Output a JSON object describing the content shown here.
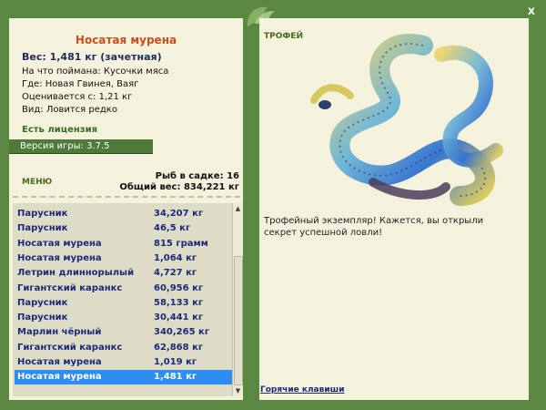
{
  "window": {
    "close_glyph": "x"
  },
  "fish": {
    "title": "Носатая мурена",
    "weight_line": "Вес: 1,481 кг (зачетная)",
    "details": [
      "На что поймана: Кусочки мяса",
      "Где: Новая Гвинея, Ваяг",
      "Оценивается с: 1,21 кг",
      "Вид: Ловится редко"
    ]
  },
  "license": "Есть лицензия",
  "version": "Версия игры: 3.7.5",
  "menu_label": "МЕНЮ",
  "stats": {
    "count": "Рыб в садке: 16",
    "total_weight": "Общий вес: 834,221 кг"
  },
  "catch_list": [
    {
      "name": "Парусник",
      "weight": "34,207 кг"
    },
    {
      "name": "Парусник",
      "weight": "46,5 кг"
    },
    {
      "name": "Носатая мурена",
      "weight": "815 грамм"
    },
    {
      "name": "Носатая мурена",
      "weight": "1,064 кг"
    },
    {
      "name": "Летрин длиннорылый",
      "weight": "4,727 кг"
    },
    {
      "name": "Гигантский каранкс",
      "weight": "60,956 кг"
    },
    {
      "name": "Парусник",
      "weight": "58,133 кг"
    },
    {
      "name": "Парусник",
      "weight": "30,441 кг"
    },
    {
      "name": "Марлин чёрный",
      "weight": "340,265 кг"
    },
    {
      "name": "Гигантский каранкс",
      "weight": "62,868 кг"
    },
    {
      "name": "Носатая мурена",
      "weight": "1,019 кг"
    },
    {
      "name": "Носатая мурена",
      "weight": "1,481 кг",
      "selected": true
    }
  ],
  "trophy": {
    "title": "ТРОФЕЙ",
    "text": "Трофейный экземпляр! Кажется, вы открыли секрет успешной ловли!"
  },
  "hotkeys": "Горячие клавиши",
  "colors": {
    "frame": "#5a8840",
    "panel": "#f4f1dc",
    "title_orange": "#c8501e",
    "list_text": "#1d2a78",
    "selected_row": "#2f8cf0"
  }
}
